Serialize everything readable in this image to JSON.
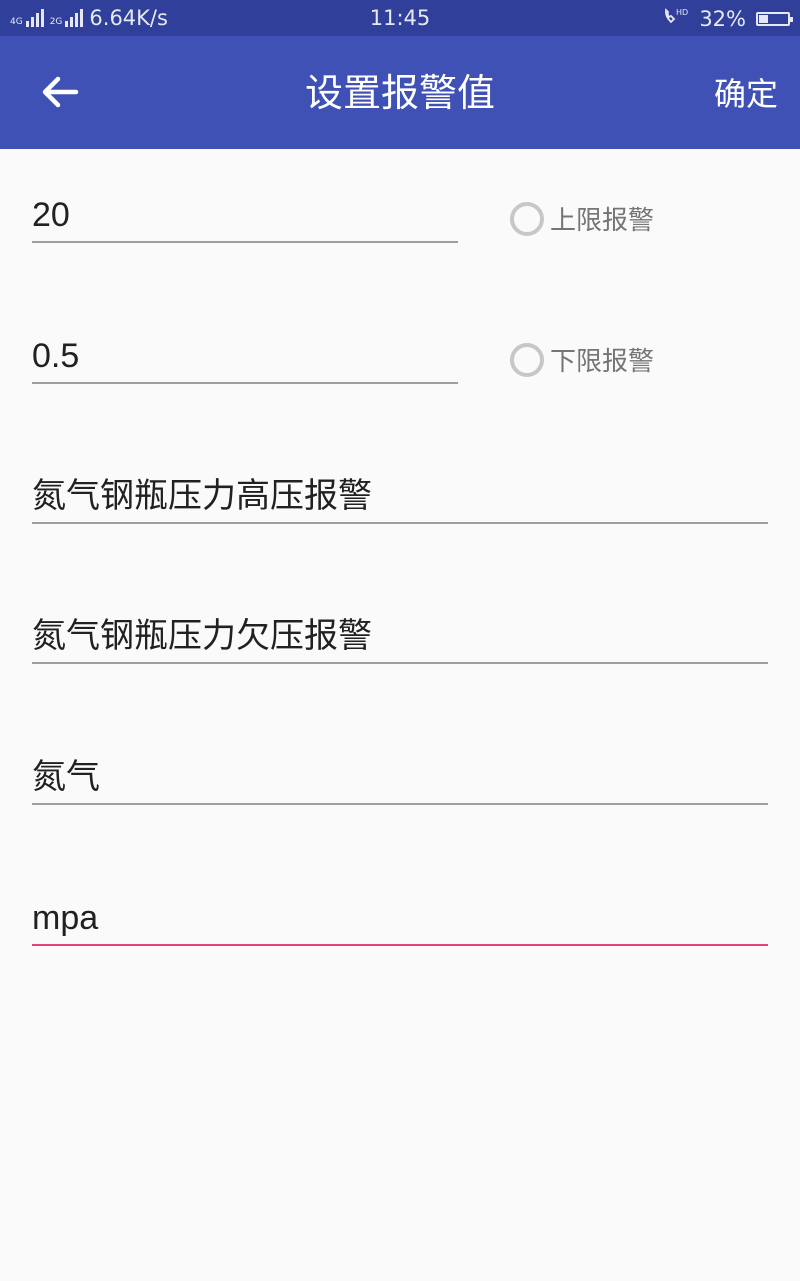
{
  "status_bar": {
    "network_speed": "6.64K/s",
    "time": "11:45",
    "battery": "32%",
    "battery_level": 0.32,
    "left_icons": [
      "4g-signal-icon",
      "4g-signal-icon"
    ],
    "right_icons": [
      "hd-call-icon",
      "battery-icon"
    ]
  },
  "app_bar": {
    "title": "设置报警值",
    "confirm_label": "确定",
    "back_icon": "arrow-left-icon",
    "color": "#3f51b5"
  },
  "form": {
    "upper_limit": {
      "value": "20",
      "radio_label": "上限报警",
      "checked": false
    },
    "lower_limit": {
      "value": "0.5",
      "radio_label": "下限报警",
      "checked": false
    },
    "high_alarm_name": {
      "value": "氮气钢瓶压力高压报警"
    },
    "low_alarm_name": {
      "value": "氮气钢瓶压力欠压报警"
    },
    "gas_name": {
      "value": "氮气"
    },
    "unit": {
      "value": "mpa"
    },
    "accent_color": "#e8417a"
  }
}
